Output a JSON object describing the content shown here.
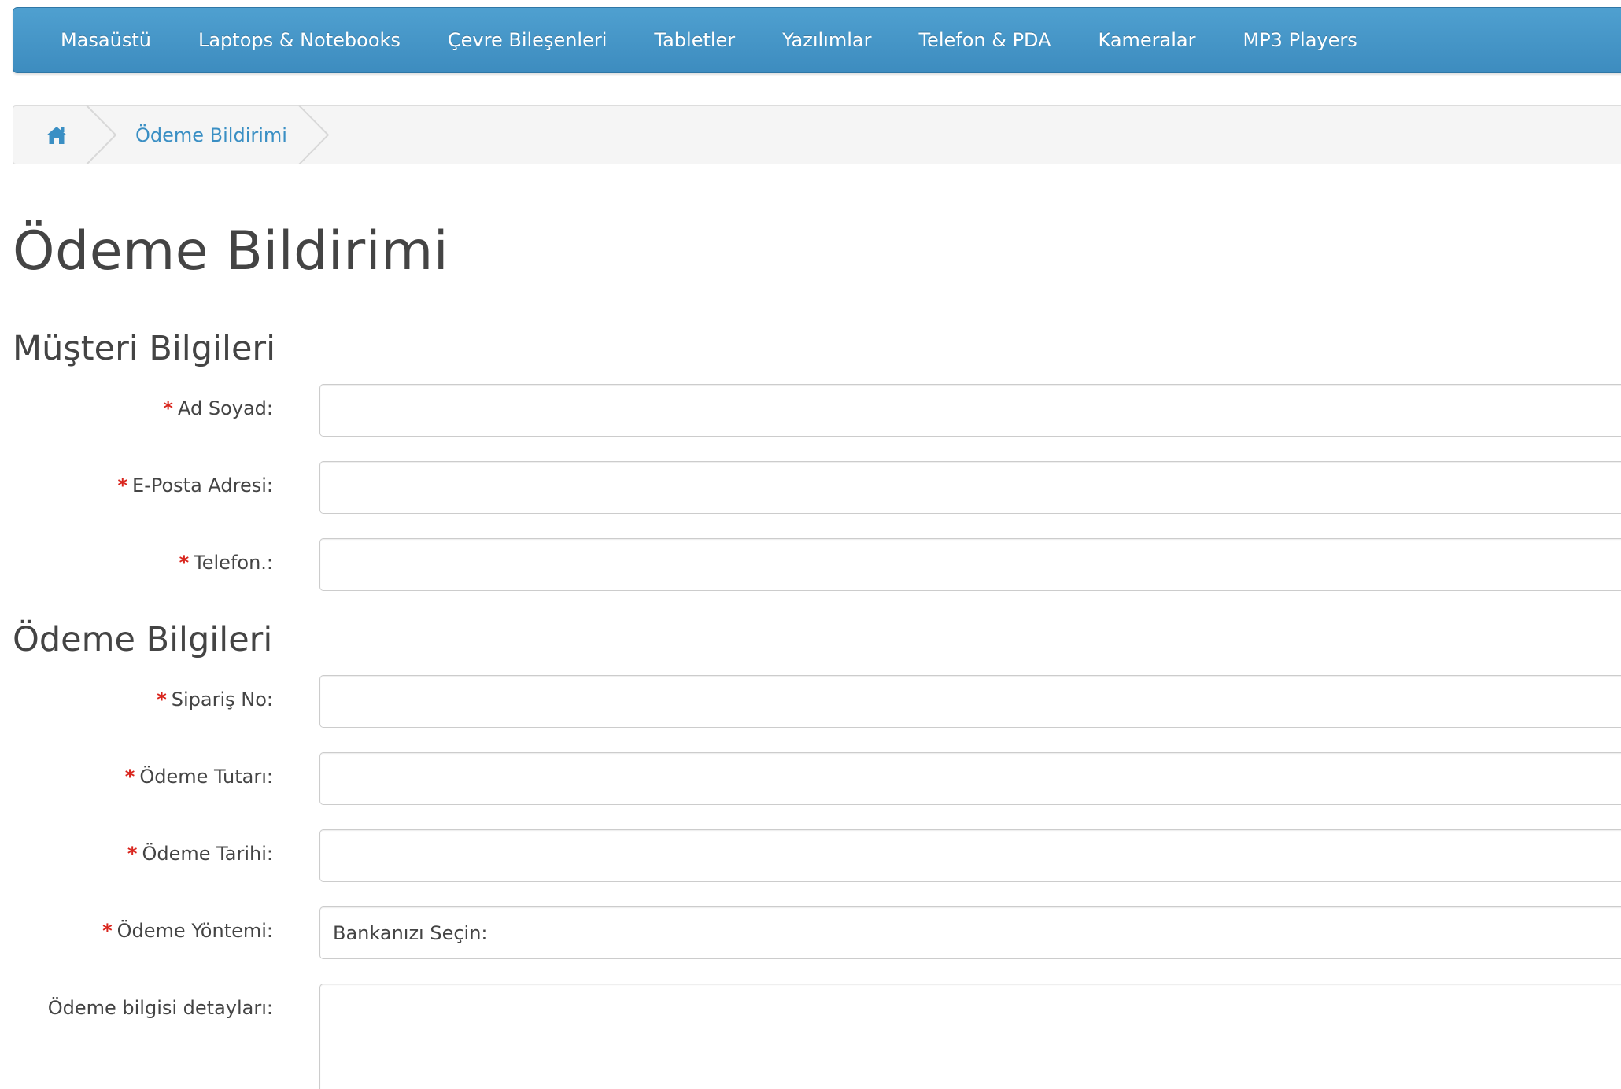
{
  "nav": {
    "items": [
      {
        "label": "Masaüstü"
      },
      {
        "label": "Laptops & Notebooks"
      },
      {
        "label": "Çevre Bileşenleri"
      },
      {
        "label": "Tabletler"
      },
      {
        "label": "Yazılımlar"
      },
      {
        "label": "Telefon & PDA"
      },
      {
        "label": "Kameralar"
      },
      {
        "label": "MP3 Players"
      }
    ]
  },
  "breadcrumb": {
    "home_icon": "home-icon",
    "current": "Ödeme Bildirimi"
  },
  "page": {
    "title": "Ödeme Bildirimi"
  },
  "customer": {
    "heading": "Müşteri Bilgileri",
    "required_mark": "*",
    "name_label": "Ad Soyad:",
    "email_label": "E-Posta Adresi:",
    "phone_label": "Telefon.:"
  },
  "payment": {
    "heading": "Ödeme Bilgileri",
    "order_label": "Sipariş No:",
    "amount_label": "Ödeme Tutarı:",
    "date_label": "Ödeme Tarihi:",
    "method_label": "Ödeme Yöntemi:",
    "method_selected": "Bankanızı Seçin:",
    "details_label": "Ödeme bilgisi detayları:"
  },
  "colors": {
    "nav_bg": "#4fa0d0",
    "link": "#3a8fc4",
    "required": "#d9251d"
  }
}
